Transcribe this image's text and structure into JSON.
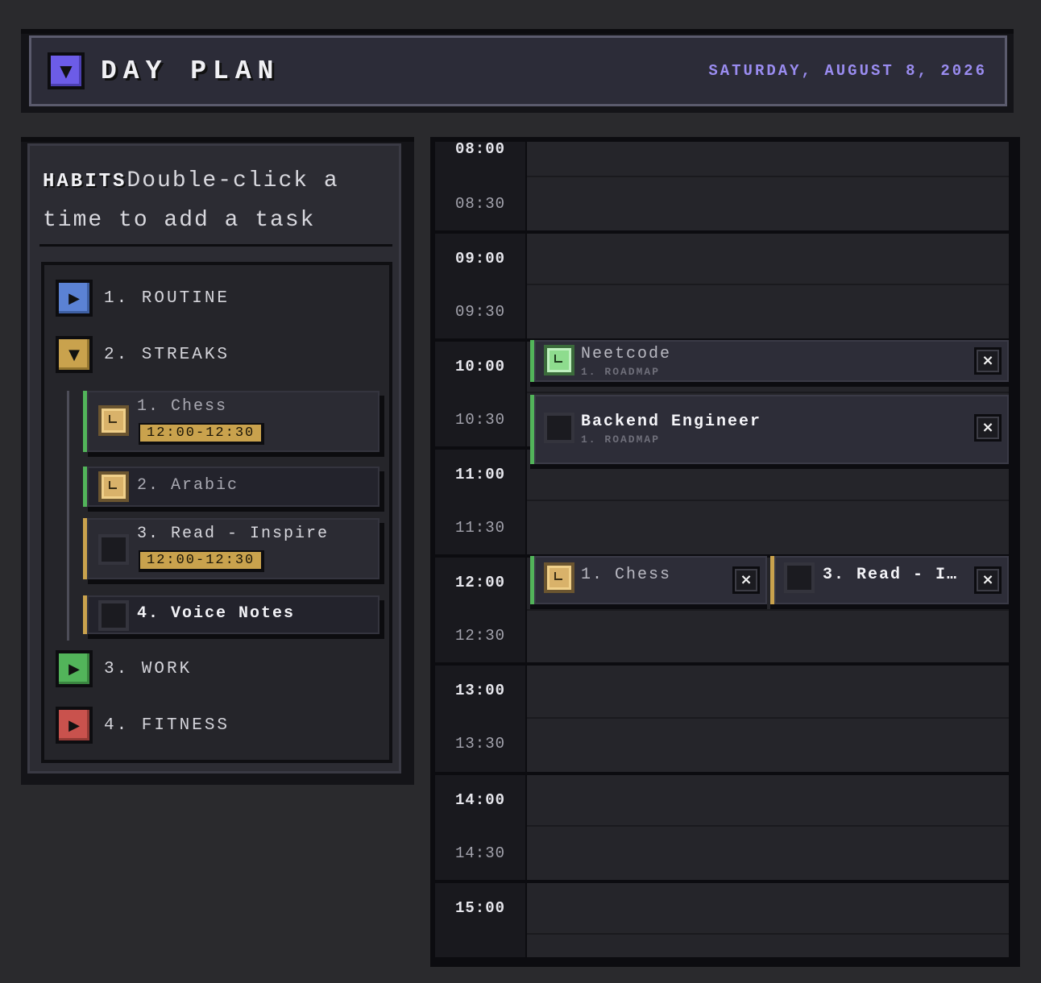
{
  "header": {
    "title": "DAY PLAN",
    "date": "SATURDAY, AUGUST 8, 2026",
    "toggle_glyph": "▼",
    "accent": "#6c5ce7"
  },
  "sidebar": {
    "heading": "HABITS",
    "hint": "Double-click a time to add a task",
    "categories": [
      {
        "label": "1. ROUTINE",
        "glyph": "▶",
        "color": "#5b82d4",
        "expanded": false
      },
      {
        "label": "2. STREAKS",
        "glyph": "▼",
        "color": "#c9a24d",
        "expanded": true
      },
      {
        "label": "3. WORK",
        "glyph": "▶",
        "color": "#52b45a",
        "expanded": false
      },
      {
        "label": "4. FITNESS",
        "glyph": "▶",
        "color": "#c9524d",
        "expanded": false
      }
    ],
    "streak_items": [
      {
        "label": "1. Chess",
        "time": "12:00-12:30",
        "checked": true,
        "icon": "clock-icon"
      },
      {
        "label": "2. Arabic",
        "checked": true,
        "icon": "clock-icon"
      },
      {
        "label": "3. Read - Inspire",
        "time": "12:00-12:30",
        "checked": false
      },
      {
        "label": "4. Voice Notes",
        "checked": false
      }
    ]
  },
  "schedule": {
    "times": [
      "08:00",
      "08:30",
      "09:00",
      "09:30",
      "10:00",
      "10:30",
      "11:00",
      "11:30",
      "12:00",
      "12:30",
      "13:00",
      "13:30",
      "14:00",
      "14:30",
      "15:00"
    ],
    "events": [
      {
        "title": "Neetcode",
        "subtitle": "1. ROADMAP",
        "checked": true,
        "start": "10:00"
      },
      {
        "title": "Backend Engineer",
        "subtitle": "1. ROADMAP",
        "checked": false,
        "start": "10:30"
      },
      {
        "title": "1. Chess",
        "checked": true,
        "start": "12:00"
      },
      {
        "title": "3. Read - I…",
        "checked": false,
        "start": "12:00"
      }
    ],
    "close_glyph": "×"
  }
}
